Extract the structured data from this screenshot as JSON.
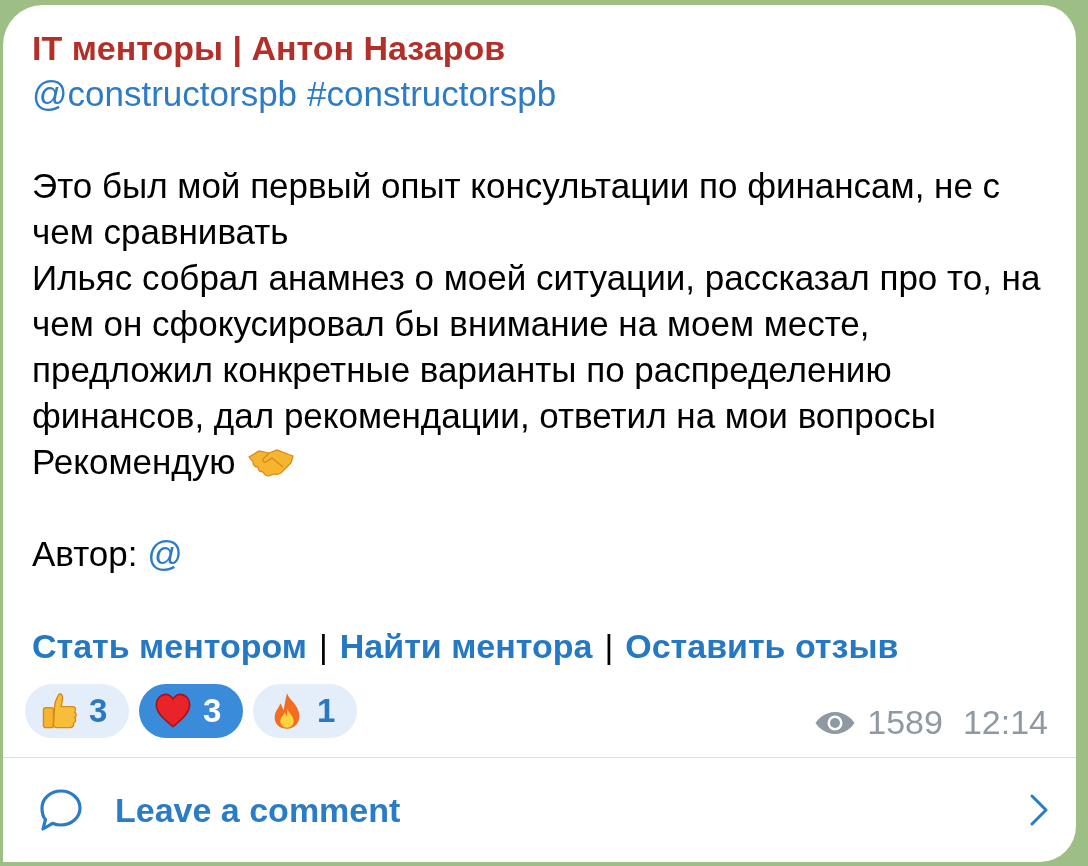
{
  "channel": {
    "title": "IT менторы | Антон Назаров",
    "mention": "@constructorspb",
    "hashtag": "#constructorspb"
  },
  "body_lines": [
    {
      "kind": "plain",
      "text": "Это был мой первый опыт консультации по финансам, не с"
    },
    {
      "kind": "plain",
      "text": "чем сравнивать"
    },
    {
      "kind": "plain",
      "text": "Ильяс собрал анамнез о моей ситуации, рассказал про то, на"
    },
    {
      "kind": "plain",
      "text": "чем он сфокусировал бы внимание на моем месте,"
    },
    {
      "kind": "plain",
      "text": "предложил конкретные варианты по распределению"
    },
    {
      "kind": "plain",
      "text": "финансов, дал рекомендации, ответил на мои вопросы"
    },
    {
      "kind": "handshake",
      "text": "Рекомендую"
    }
  ],
  "author": {
    "label": "Автор:",
    "link": "@"
  },
  "links": [
    {
      "kind": "link",
      "label": "Стать ментором"
    },
    {
      "kind": "separator",
      "label": "|"
    },
    {
      "kind": "link",
      "label": "Найти ментора"
    },
    {
      "kind": "separator",
      "label": "|"
    },
    {
      "kind": "link",
      "label": "Оставить отзыв"
    }
  ],
  "reactions": [
    {
      "kind": "thumbs_up",
      "count": "3",
      "selected": false
    },
    {
      "kind": "heart",
      "count": "3",
      "selected": true
    },
    {
      "kind": "fire",
      "count": "1",
      "selected": false
    }
  ],
  "views": "1589",
  "time": "12:14",
  "comments": {
    "label": "Leave a comment"
  }
}
